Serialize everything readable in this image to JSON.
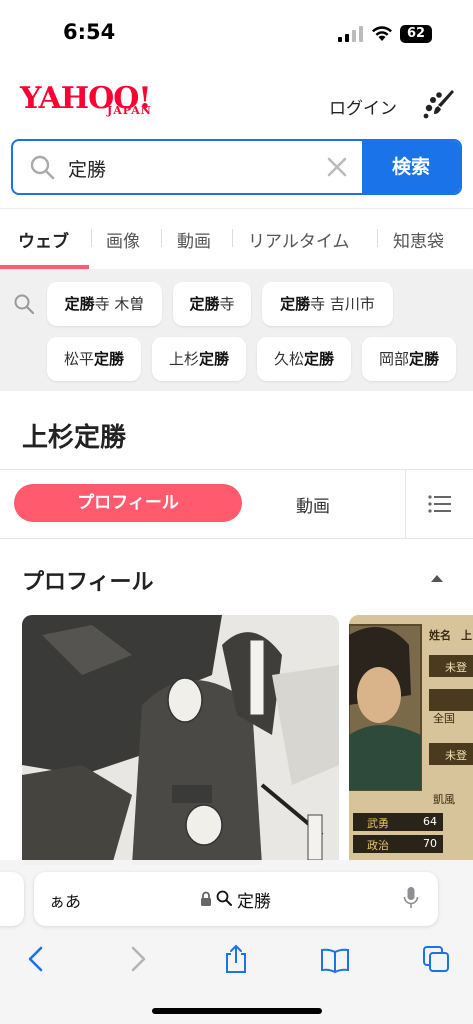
{
  "status": {
    "time": "6:54",
    "battery": "62"
  },
  "header": {
    "logo": "YAHOO!",
    "logo_sub": "JAPAN",
    "login": "ログイン"
  },
  "search": {
    "query": "定勝",
    "button": "検索"
  },
  "tabs": [
    "ウェブ",
    "画像",
    "動画",
    "リアルタイム",
    "知恵袋"
  ],
  "suggestions": [
    {
      "pre": "",
      "bold": "定勝",
      "post": "寺 木曽"
    },
    {
      "pre": "",
      "bold": "定勝",
      "post": "寺"
    },
    {
      "pre": "",
      "bold": "定勝",
      "post": "寺 吉川市"
    },
    {
      "pre": "松平",
      "bold": "定勝",
      "post": ""
    },
    {
      "pre": "上杉",
      "bold": "定勝",
      "post": ""
    },
    {
      "pre": "久松",
      "bold": "定勝",
      "post": ""
    },
    {
      "pre": "岡部",
      "bold": "定勝",
      "post": ""
    }
  ],
  "entity": {
    "title": "上杉定勝",
    "subtabs": {
      "profile": "プロフィール",
      "video": "動画"
    },
    "section_title": "プロフィール",
    "card2": {
      "name_label": "姓名",
      "name_char": "上",
      "row_a": "未登",
      "row_b": "全国",
      "row_c": "未登",
      "row_d": "凱風",
      "stat1_label": "武勇",
      "stat1_value": "64",
      "stat2_label": "政治",
      "stat2_value": "70"
    }
  },
  "safari": {
    "aa": "ぁあ",
    "url": "定勝"
  },
  "colors": {
    "yahoo_red": "#ff0033",
    "accent_blue": "#1a73e8",
    "pink": "#ff5a6e",
    "ios_blue": "#1a73e8"
  }
}
